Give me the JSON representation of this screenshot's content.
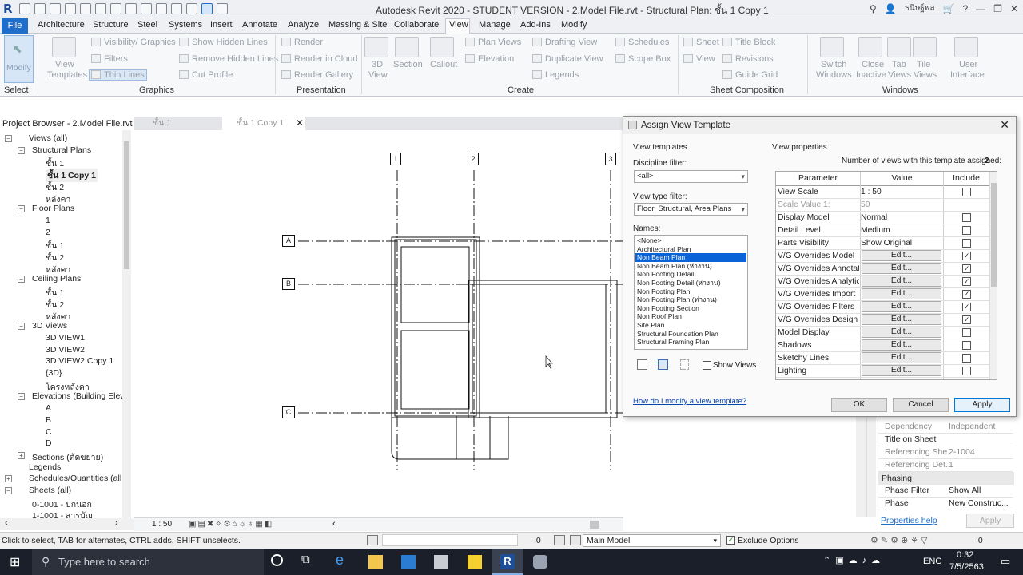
{
  "titlebar": {
    "logo": "R",
    "title": "Autodesk Revit 2020 - STUDENT VERSION - 2.Model File.rvt - Structural Plan: ชั้น 1 Copy 1",
    "user": "ธนิษฐ์พล",
    "help": "?"
  },
  "ribbon_tabs": [
    "File",
    "Architecture",
    "Structure",
    "Steel",
    "Systems",
    "Insert",
    "Annotate",
    "Analyze",
    "Massing & Site",
    "Collaborate",
    "View",
    "Manage",
    "Add-Ins",
    "Modify"
  ],
  "ribbon": {
    "modify": "Modify",
    "select": "Select",
    "view_templates": [
      "View",
      "Templates"
    ],
    "graphics_items": [
      "Visibility/ Graphics",
      "Filters",
      "Thin Lines",
      "Show  Hidden Lines",
      "Remove  Hidden Lines",
      "Cut  Profile"
    ],
    "presentation_items": [
      "Render",
      "Render  in Cloud",
      "Render  Gallery"
    ],
    "create_big": [
      "3D",
      "View",
      "Section",
      "Callout"
    ],
    "create_items": [
      "Plan  Views",
      "Elevation",
      "Drafting  View",
      "Duplicate  View",
      "Legends",
      "Schedules",
      "Scope  Box"
    ],
    "sheet_items": [
      "Sheet",
      "View",
      "Title  Block",
      "Revisions",
      "Guide  Grid"
    ],
    "windows_items": [
      "Switch",
      "Windows",
      "Close",
      "Inactive",
      "Tab",
      "Views",
      "Tile",
      "Views",
      "User",
      "Interface"
    ],
    "panels": [
      "Select",
      "Graphics",
      "Presentation",
      "Create",
      "Sheet Composition",
      "Windows"
    ]
  },
  "project_browser": {
    "title": "Project Browser - 2.Model File.rvt",
    "nodes": [
      "Views (all)",
      "Structural Plans",
      "ชั้น 1",
      "ชั้น 1 Copy 1",
      "ชั้น 2",
      "หลังคา",
      "Floor Plans",
      "1",
      "2",
      "ชั้น 1",
      "ชั้น 2",
      "หลังคา",
      "Ceiling Plans",
      "ชั้น 1",
      "ชั้น 2",
      "หลังคา",
      "3D Views",
      "3D VIEW1",
      "3D VIEW2",
      "3D VIEW2 Copy 1",
      "{3D}",
      "โครงหลังคา",
      "Elevations (Building Eleva",
      "A",
      "B",
      "C",
      "D",
      "Sections (ตัดขยาย)",
      "Legends",
      "Schedules/Quantities (all",
      "Sheets (all)",
      "0-1001 - ปกนอก",
      "1-1001 - สารบัญ"
    ]
  },
  "view_tabs": [
    "ชั้น 1",
    "ชั้น 1 Copy 1"
  ],
  "grid": {
    "columns": [
      "1",
      "2",
      "3"
    ],
    "rows": [
      "A",
      "B",
      "C"
    ]
  },
  "view_bar": {
    "scale": "1 : 50"
  },
  "dialog": {
    "title": "Assign View Template",
    "view_templates_label": "View templates",
    "discipline_label": "Discipline filter:",
    "discipline_value": "<all>",
    "viewtype_label": "View type filter:",
    "viewtype_value": "Floor, Structural, Area Plans",
    "names_label": "Names:",
    "names": [
      "<None>",
      "Architectural Plan",
      "Non Beam Plan",
      "Non Beam Plan (ห่างาน)",
      "Non Footing Detail",
      "Non Footing Detail (ห่างาน)",
      "Non Footing Plan",
      "Non Footing Plan (ห่างาน)",
      "Non Footing Section",
      "Non Roof Plan",
      "Site Plan",
      "Structural Foundation Plan",
      "Structural Framing Plan"
    ],
    "selected_name": "Non Beam Plan",
    "show_views": "Show Views",
    "help_link": "How do I modify a view template?",
    "view_properties_label": "View properties",
    "num_views_label": "Number of views with this template assigned:",
    "num_views": "2",
    "columns": [
      "Parameter",
      "Value",
      "Include"
    ],
    "rows": [
      {
        "param": "View Scale",
        "value": "1 : 50",
        "button": false,
        "include": false,
        "grey": false
      },
      {
        "param": "Scale Value  1:",
        "value": "50",
        "button": false,
        "include": null,
        "grey": true
      },
      {
        "param": "Display Model",
        "value": "Normal",
        "button": false,
        "include": false,
        "grey": false
      },
      {
        "param": "Detail Level",
        "value": "Medium",
        "button": false,
        "include": false,
        "grey": false
      },
      {
        "param": "Parts Visibility",
        "value": "Show Original",
        "button": false,
        "include": false,
        "grey": false
      },
      {
        "param": "V/G Overrides Model",
        "value": "Edit...",
        "button": true,
        "include": true,
        "grey": false
      },
      {
        "param": "V/G Overrides Annotati",
        "value": "Edit...",
        "button": true,
        "include": true,
        "grey": false
      },
      {
        "param": "V/G Overrides Analytic",
        "value": "Edit...",
        "button": true,
        "include": true,
        "grey": false
      },
      {
        "param": "V/G Overrides Import",
        "value": "Edit...",
        "button": true,
        "include": true,
        "grey": false
      },
      {
        "param": "V/G Overrides Filters",
        "value": "Edit...",
        "button": true,
        "include": true,
        "grey": false
      },
      {
        "param": "V/G Overrides Design",
        "value": "Edit...",
        "button": true,
        "include": true,
        "grey": false
      },
      {
        "param": "Model Display",
        "value": "Edit...",
        "button": true,
        "include": false,
        "grey": false
      },
      {
        "param": "Shadows",
        "value": "Edit...",
        "button": true,
        "include": false,
        "grey": false
      },
      {
        "param": "Sketchy Lines",
        "value": "Edit...",
        "button": true,
        "include": false,
        "grey": false
      },
      {
        "param": "Lighting",
        "value": "Edit...",
        "button": true,
        "include": false,
        "grey": false
      }
    ],
    "ok": "OK",
    "cancel": "Cancel",
    "apply": "Apply"
  },
  "properties": {
    "rows": [
      {
        "key": "Dependency",
        "value": "Independent",
        "grey": true
      },
      {
        "key": "Title on Sheet",
        "value": "",
        "grey": false
      },
      {
        "key": "Referencing She...",
        "value": "2-1004",
        "grey": true
      },
      {
        "key": "Referencing Det...",
        "value": "1",
        "grey": true
      }
    ],
    "section": "Phasing",
    "phase_rows": [
      {
        "key": "Phase Filter",
        "value": "Show All"
      },
      {
        "key": "Phase",
        "value": "New Construc..."
      }
    ],
    "help": "Properties help",
    "apply": "Apply"
  },
  "status": {
    "hint": "Click to select, TAB for alternates, CTRL adds, SHIFT unselects.",
    "zero1": ":0",
    "model": "Main Model",
    "exclude": "Exclude Options",
    "zero2": ":0"
  },
  "taskbar": {
    "search": "Type here to search",
    "lang": "ENG",
    "time": "0:32",
    "date": "7/5/2563"
  },
  "colors": {
    "accent": "#1f6ecc",
    "selection": "#0a64d8",
    "taskbar": "#1a1f2a"
  }
}
